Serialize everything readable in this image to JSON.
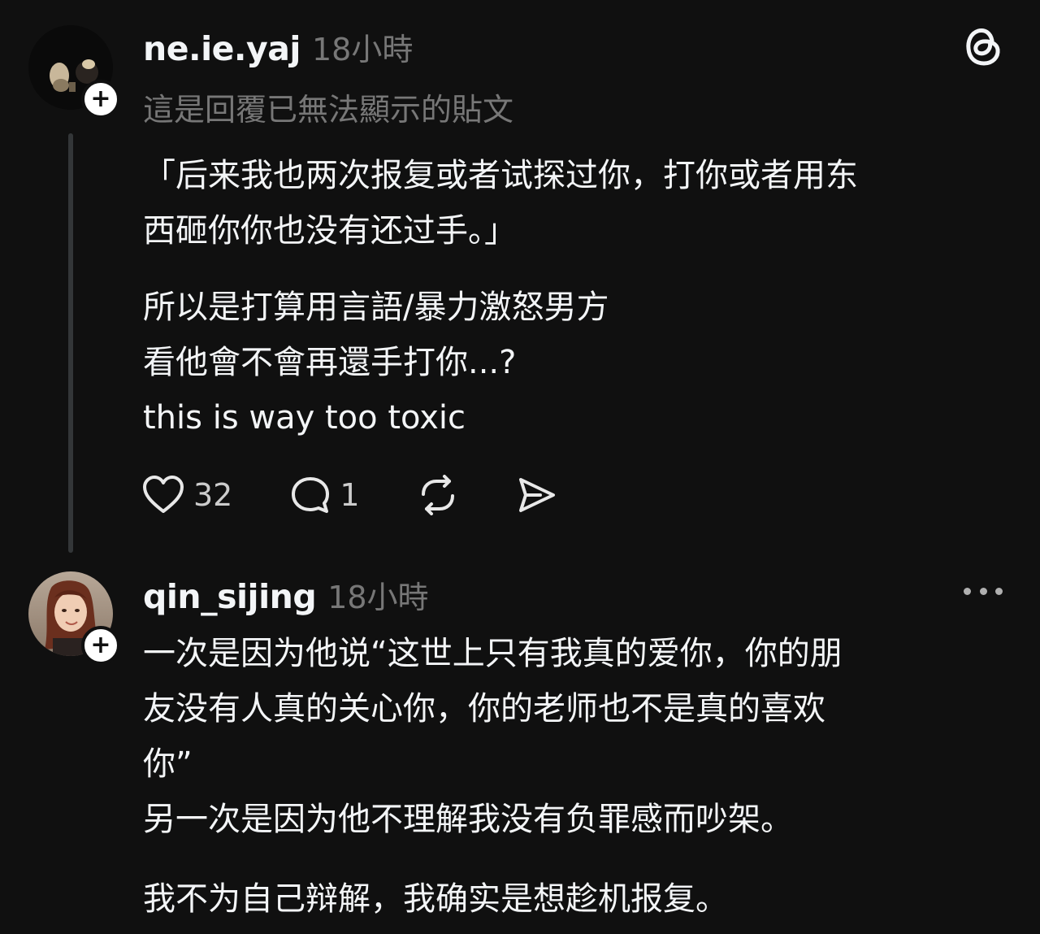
{
  "post1": {
    "username": "ne.ie.yaj",
    "time": "18小時",
    "reply_note": "這是回覆已無法顯示的貼文",
    "quote_line1": "「后来我也两次报复或者试探过你，打你或者用东",
    "quote_line2": "西砸你你也没有还过手。」",
    "body_line1": "所以是打算用言語/暴力激怒男方",
    "body_line2": "看他會不會再還手打你...?",
    "body_line3": "this is way too toxic",
    "likes": "32",
    "replies": "1"
  },
  "post2": {
    "username": "qin_sijing",
    "time": "18小時",
    "line1": "一次是因为他说“这世上只有我真的爱你，你的朋",
    "line2": "友没有人真的关心你，你的老师也不是真的喜欢",
    "line3": "你”",
    "line4": "另一次是因为他不理解我没有负罪感而吵架。",
    "line5": "我不为自己辩解，我确实是想趁机报复。"
  },
  "icons": {
    "follow": "+",
    "like": "heart-icon",
    "reply": "comment-icon",
    "repost": "repost-icon",
    "share": "send-icon",
    "threads": "threads-logo-icon",
    "more": "more-icon"
  },
  "colors": {
    "background": "#101010",
    "text": "#f3f5f7",
    "secondary": "#777777",
    "thread_line": "#333638"
  }
}
